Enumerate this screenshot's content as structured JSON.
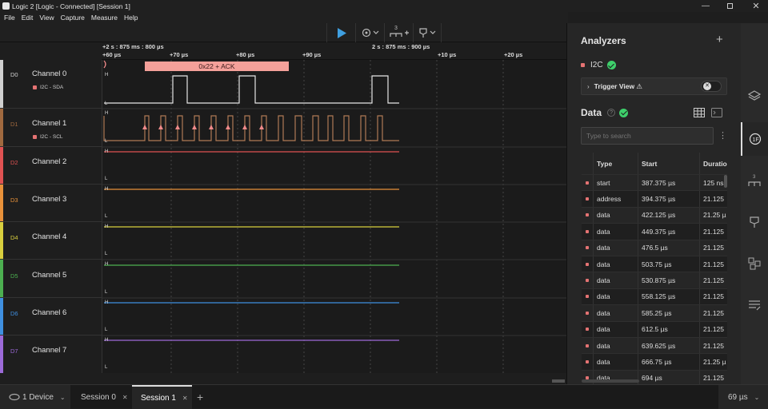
{
  "window": {
    "title": "Logic 2 [Logic - Connected] [Session 1]"
  },
  "menu": [
    "File",
    "Edit",
    "View",
    "Capture",
    "Measure",
    "Help"
  ],
  "ruler": {
    "origin_label": "+2 s : 875 ms : 800 µs",
    "start_label": "+60 µs",
    "ticks": [
      "+70 µs",
      "+80 µs",
      "+90 µs",
      "+10 µs",
      "+20 µs"
    ],
    "mid_label": "2 s : 875 ms : 900 µs"
  },
  "decode_bubble": "0x22 + ACK",
  "channels": [
    {
      "id": "D0",
      "name": "Channel 0",
      "analyzer": "I2C - SDA",
      "color": "#d0d0d0"
    },
    {
      "id": "D1",
      "name": "Channel 1",
      "analyzer": "I2C - SCL",
      "color": "#a0693f"
    },
    {
      "id": "D2",
      "name": "Channel 2",
      "analyzer": "",
      "color": "#e05252"
    },
    {
      "id": "D3",
      "name": "Channel 3",
      "analyzer": "",
      "color": "#e8913a"
    },
    {
      "id": "D4",
      "name": "Channel 4",
      "analyzer": "",
      "color": "#d8cf3e"
    },
    {
      "id": "D5",
      "name": "Channel 5",
      "analyzer": "",
      "color": "#4caf50"
    },
    {
      "id": "D6",
      "name": "Channel 6",
      "analyzer": "",
      "color": "#3f8fe0"
    },
    {
      "id": "D7",
      "name": "Channel 7",
      "analyzer": "",
      "color": "#9c6ad8"
    }
  ],
  "level_labels": {
    "high": "H",
    "low": "L"
  },
  "toolbar": {
    "marker_count": "3"
  },
  "analyzers": {
    "title": "Analyzers",
    "add": "+",
    "items": [
      {
        "name": "I2C"
      }
    ],
    "trigger_view": "Trigger View ⚠"
  },
  "data_panel": {
    "title": "Data",
    "help": "?",
    "search_placeholder": "Type to search",
    "more": "⋮",
    "columns": [
      "Type",
      "Start",
      "Duration"
    ],
    "rows": [
      {
        "type": "start",
        "start": "387.375 µs",
        "duration": "125 ns"
      },
      {
        "type": "address",
        "start": "394.375 µs",
        "duration": "21.125"
      },
      {
        "type": "data",
        "start": "422.125 µs",
        "duration": "21.25 µ"
      },
      {
        "type": "data",
        "start": "449.375 µs",
        "duration": "21.125"
      },
      {
        "type": "data",
        "start": "476.5 µs",
        "duration": "21.125"
      },
      {
        "type": "data",
        "start": "503.75 µs",
        "duration": "21.125"
      },
      {
        "type": "data",
        "start": "530.875 µs",
        "duration": "21.125"
      },
      {
        "type": "data",
        "start": "558.125 µs",
        "duration": "21.125"
      },
      {
        "type": "data",
        "start": "585.25 µs",
        "duration": "21.125"
      },
      {
        "type": "data",
        "start": "612.5 µs",
        "duration": "21.125"
      },
      {
        "type": "data",
        "start": "639.625 µs",
        "duration": "21.125"
      },
      {
        "type": "data",
        "start": "666.75 µs",
        "duration": "21.25 µ"
      },
      {
        "type": "data",
        "start": "694 µs",
        "duration": "21.125"
      }
    ]
  },
  "statusbar": {
    "device": "1 Device",
    "tabs": [
      "Session 0",
      "Session 1"
    ],
    "active_tab": "Session 1",
    "add_tab": "+",
    "zoom": "69 µs"
  },
  "colors": {
    "accent": "#3f9fe0",
    "decode": "#f08a8a",
    "ok": "#3ecf6b"
  }
}
